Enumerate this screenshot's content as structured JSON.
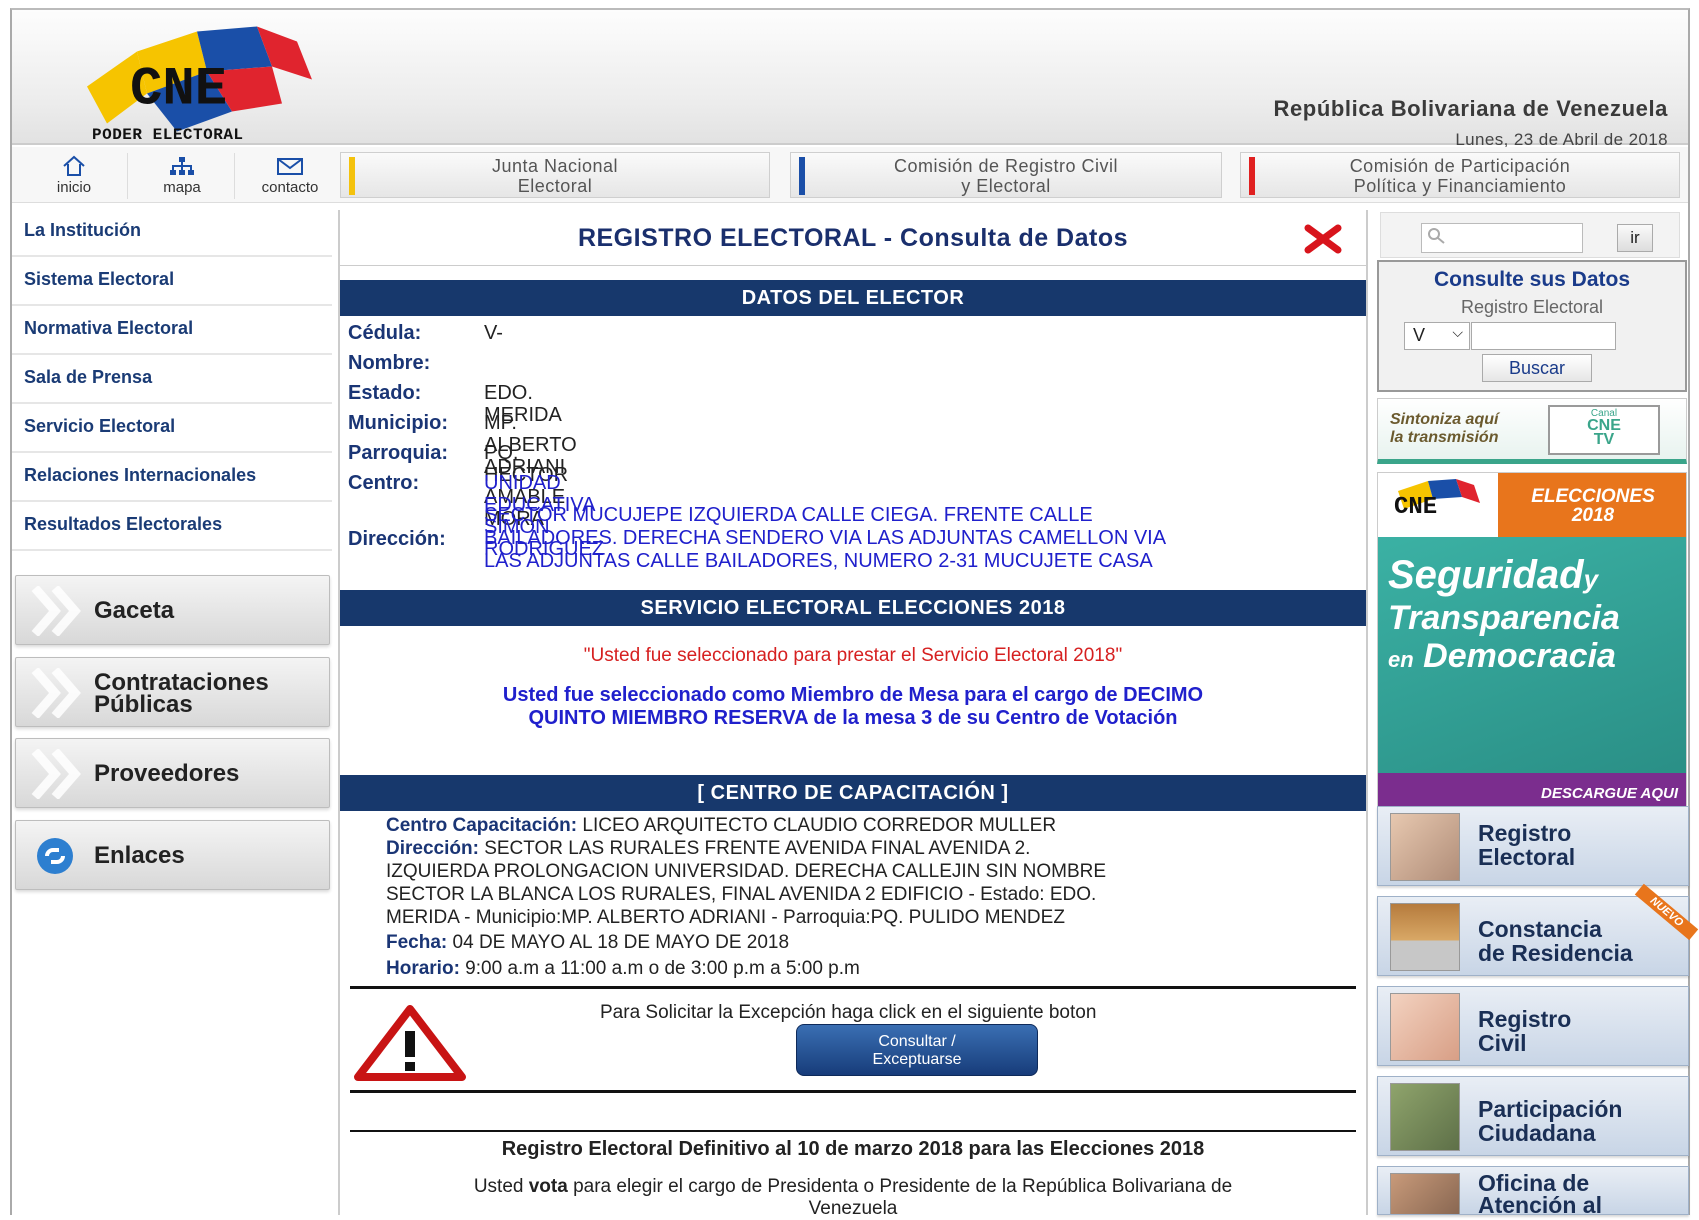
{
  "header": {
    "logo_text": "CNE",
    "logo_subtitle": "PODER ELECTORAL",
    "country": "República Bolivariana de Venezuela",
    "date": "Lunes, 23 de Abril de 2018"
  },
  "topnav": {
    "inicio": "inicio",
    "mapa": "mapa",
    "contacto": "contacto",
    "tabs": [
      {
        "line1": "Junta Nacional",
        "line2": "Electoral",
        "color": "#f4c20d"
      },
      {
        "line1": "Comisión de Registro Civil",
        "line2": "y Electoral",
        "color": "#1b4fa8"
      },
      {
        "line1": "Comisión de Participación",
        "line2": "Política y Financiamiento",
        "color": "#e02020"
      }
    ]
  },
  "sidebar": {
    "items": [
      "La Institución",
      "Sistema Electoral",
      "Normativa Electoral",
      "Sala de Prensa",
      "Servicio Electoral",
      "Relaciones Internacionales",
      "Resultados Electorales"
    ],
    "buttons": {
      "gaceta": "Gaceta",
      "contrataciones1": "Contrataciones",
      "contrataciones2": "Públicas",
      "proveedores": "Proveedores",
      "enlaces": "Enlaces"
    }
  },
  "main": {
    "title": "REGISTRO ELECTORAL - Consulta de Datos",
    "section_elector": "DATOS DEL ELECTOR",
    "fields": {
      "cedula_label": "Cédula:",
      "cedula_value": "V-",
      "nombre_label": "Nombre:",
      "nombre_value": "",
      "estado_label": "Estado:",
      "estado_value": "EDO. MERIDA",
      "municipio_label": "Municipio:",
      "municipio_value": "MP. ALBERTO ADRIANI",
      "parroquia_label": "Parroquia:",
      "parroquia_value": "PQ. HECTOR AMABLE MORA",
      "centro_label": "Centro:",
      "centro_value": "UNIDAD EDUCATIVA SIMON RODRIGUEZ",
      "direccion_label": "Dirección:",
      "direccion_l1": "SECTOR MUCUJEPE IZQUIERDA CALLE CIEGA. FRENTE CALLE",
      "direccion_l2": "BAILADORES. DERECHA SENDERO VIA LAS ADJUNTAS CAMELLON VIA",
      "direccion_l3": "LAS ADJUNTAS CALLE BAILADORES, NUMERO 2-31 MUCUJETE CASA"
    },
    "section_servicio": "SERVICIO ELECTORAL ELECCIONES 2018",
    "servicio_msg": "\"Usted fue seleccionado para prestar el Servicio Electoral 2018\"",
    "servicio_l1": "Usted fue seleccionado como Miembro de Mesa para el cargo de DECIMO",
    "servicio_l2": "QUINTO MIEMBRO RESERVA de la mesa 3 de su Centro de Votación",
    "section_capacitacion": "[ CENTRO DE CAPACITACIÓN ]",
    "cap": {
      "centro_label": "Centro Capacitación:",
      "centro_value": " LICEO ARQUITECTO CLAUDIO CORREDOR MULLER",
      "dir_label": "Dirección:",
      "dir_l1": " SECTOR LAS RURALES FRENTE AVENIDA FINAL AVENIDA 2.",
      "dir_l2": "IZQUIERDA PROLONGACION UNIVERSIDAD. DERECHA CALLEJIN SIN NOMBRE",
      "dir_l3": "SECTOR LA BLANCA LOS RURALES, FINAL AVENIDA 2 EDIFICIO - Estado: EDO.",
      "dir_l4": "MERIDA - Municipio:MP. ALBERTO ADRIANI - Parroquia:PQ. PULIDO MENDEZ",
      "fecha_label": "Fecha:",
      "fecha_value": " 04 DE MAYO AL 18 DE MAYO DE 2018",
      "horario_label": "Horario:",
      "horario_value": " 9:00 a.m a 11:00 a.m o de 3:00 p.m a 5:00 p.m"
    },
    "excepcion_text": "Para Solicitar la Excepción haga click en el siguiente boton",
    "btn_l1": "Consultar /",
    "btn_l2": "Exceptuarse",
    "registro_def": "Registro Electoral Definitivo al 10 de marzo 2018 para las Elecciones 2018",
    "vota_pre": "Usted ",
    "vota_bold": "vota",
    "vota_post": " para elegir el cargo de Presidenta o Presidente de la República Bolivariana de",
    "vota_l2": "Venezuela"
  },
  "right": {
    "search_button": "ir",
    "consult_title": "Consulte sus Datos",
    "consult_sub": "Registro Electoral",
    "select_value": "V",
    "buscar": "Buscar",
    "tv_l1": "Sintoniza aquí",
    "tv_l2": "la transmisión",
    "tv_canal": "Canal",
    "tv_cne": "CNE",
    "tv_tv": "TV",
    "elec_l1": "ELECCIONES",
    "elec_l2": "2018",
    "seg1": "Seguridad",
    "seg_y": "y",
    "seg2": "Transparencia",
    "seg_en": "en",
    "seg3": "Democracia",
    "descargue": "DESCARGUE AQUI",
    "cards": [
      {
        "l1": "Registro",
        "l2": "Electoral"
      },
      {
        "l1": "Constancia",
        "l2": "de Residencia",
        "badge": "NUEVO"
      },
      {
        "l1": "Registro",
        "l2": "Civil"
      },
      {
        "l1": "Participación",
        "l2": "Ciudadana"
      },
      {
        "l1": "Oficina de",
        "l2": "Atención al"
      }
    ]
  }
}
